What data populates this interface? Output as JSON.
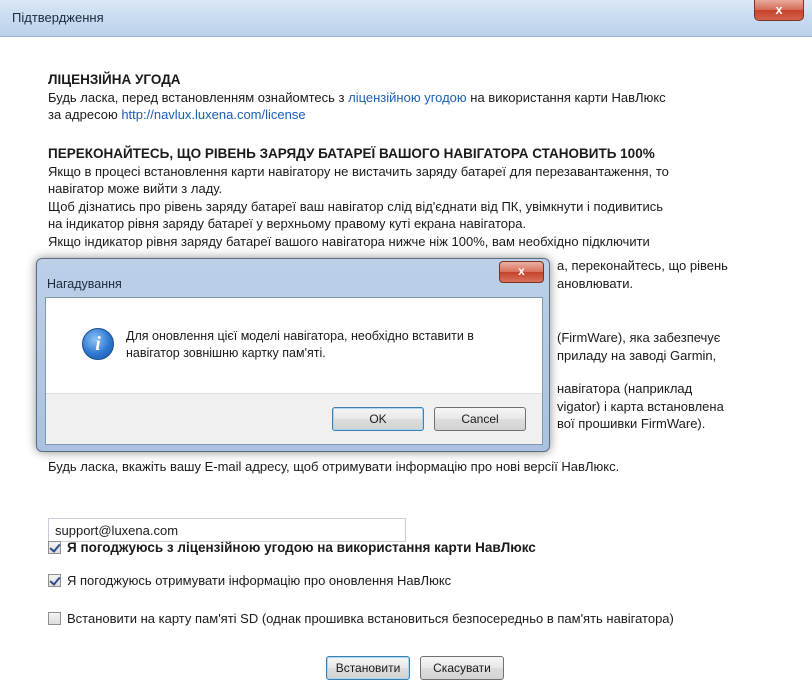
{
  "window": {
    "title": "Підтвердження",
    "close": "x"
  },
  "license": {
    "heading": "ЛІЦЕНЗІЙНА УГОДА",
    "text_before": "Будь ласка, перед встановленням ознайомтесь з ",
    "link_text": "ліцензійною угодою",
    "text_after": " на використання карти НавЛюкс",
    "address_prefix": "за адресою ",
    "url": "http://navlux.luxena.com/license"
  },
  "battery": {
    "heading": "ПЕРЕКОНАЙТЕСЬ, ЩО РІВЕНЬ ЗАРЯДУ БАТАРЕЇ ВАШОГО НАВІГАТОРА СТАНОВИТЬ 100%",
    "lines": [
      "Якщо в процесі встановлення карти навігатору не вистачить заряду батареї для перезавантаження, то",
      "навігатор може вийти з ладу.",
      "Щоб дізнатись про рівень заряду батареї ваш навігатор слід від'єднати від ПК, увімкнути і подивитись",
      "на індикатор рівня заряду батареї у верхньому правому куті екрана навігатора.",
      "Якщо індикатор рівня заряду батареї вашого навігатора нижче ніж 100%, вам необхідно підключити"
    ],
    "visible_fragments": [
      "а, переконайтесь, що рівень",
      "ановлювати."
    ]
  },
  "firmware_fragments": [
    "(FirmWare), яка забезпечує",
    "приладу на заводі Garmin,",
    "навігатора (наприклад",
    "vigator) і карта встановлена",
    "вої прошивки FirmWare)."
  ],
  "email": {
    "prompt": "Будь ласка, вкажіть вашу E-mail адресу, щоб отримувати інформацію про нові версії НавЛюкс.",
    "value": "support@luxena.com"
  },
  "checks": [
    {
      "label": "Я погоджуюсь з ліцензійною угодою на використання карти НавЛюкс",
      "checked": true,
      "bold": true
    },
    {
      "label": "Я погоджуюсь отримувати інформацію про оновлення НавЛюкс",
      "checked": true,
      "bold": false
    },
    {
      "label": "Встановити на карту пам'яті SD (однак прошивка встановиться безпосередньо в пам'ять навігатора)",
      "checked": false,
      "bold": false
    }
  ],
  "buttons": {
    "install": "Встановити",
    "cancel": "Скасувати"
  },
  "dialog": {
    "title": "Нагадування",
    "close": "x",
    "icon": "info-icon",
    "message": "Для оновлення цієї моделі навігатора, необхідно вставити в навігатор зовнішню картку пам'яті.",
    "ok": "OK",
    "cancel": "Cancel"
  }
}
